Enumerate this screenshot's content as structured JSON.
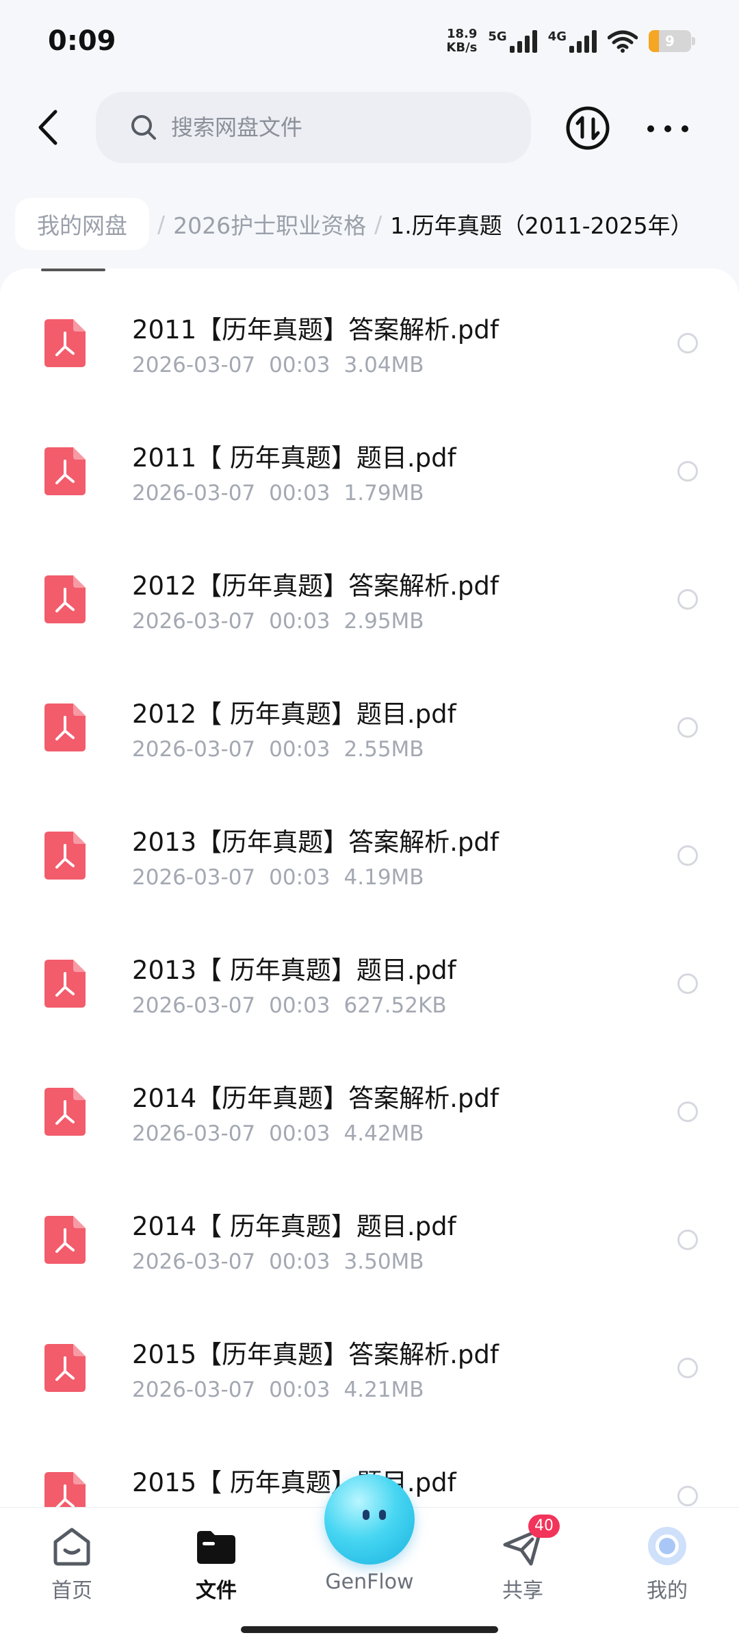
{
  "status_bar": {
    "time": "0:09",
    "speed_value": "18.9",
    "speed_unit": "KB/s",
    "net1": "5G",
    "net2": "4G",
    "battery": "9"
  },
  "header": {
    "search_placeholder": "搜索网盘文件"
  },
  "breadcrumb": {
    "items": [
      "我的网盘",
      "2026护士职业资格",
      "1.历年真题（2011-2025年）"
    ],
    "separator": "/"
  },
  "files": [
    {
      "name": "2011【历年真题】答案解析.pdf",
      "date": "2026-03-07",
      "time": "00:03",
      "size": "3.04MB"
    },
    {
      "name": "2011【 历年真题】题目.pdf",
      "date": "2026-03-07",
      "time": "00:03",
      "size": "1.79MB"
    },
    {
      "name": "2012【历年真题】答案解析.pdf",
      "date": "2026-03-07",
      "time": "00:03",
      "size": "2.95MB"
    },
    {
      "name": "2012【 历年真题】题目.pdf",
      "date": "2026-03-07",
      "time": "00:03",
      "size": "2.55MB"
    },
    {
      "name": "2013【历年真题】答案解析.pdf",
      "date": "2026-03-07",
      "time": "00:03",
      "size": "4.19MB"
    },
    {
      "name": "2013【 历年真题】题目.pdf",
      "date": "2026-03-07",
      "time": "00:03",
      "size": "627.52KB"
    },
    {
      "name": "2014【历年真题】答案解析.pdf",
      "date": "2026-03-07",
      "time": "00:03",
      "size": "4.42MB"
    },
    {
      "name": "2014【 历年真题】题目.pdf",
      "date": "2026-03-07",
      "time": "00:03",
      "size": "3.50MB"
    },
    {
      "name": "2015【历年真题】答案解析.pdf",
      "date": "2026-03-07",
      "time": "00:03",
      "size": "4.21MB"
    },
    {
      "name": "2015【 历年真题】题目.pdf",
      "date": "",
      "time": "",
      "size": ""
    }
  ],
  "bottom_nav": {
    "home": "首页",
    "files": "文件",
    "genflow": "GenFlow",
    "share": "共享",
    "share_badge": "40",
    "mine": "我的"
  },
  "colors": {
    "pdf_icon": "#f25c6b",
    "accent_orb": "#3cc8ec",
    "badge": "#f2335a"
  },
  "icons": [
    "back-icon",
    "search-icon",
    "sort-icon",
    "more-icon",
    "pdf-icon",
    "home-icon",
    "folder-icon",
    "share-icon",
    "profile-icon"
  ]
}
